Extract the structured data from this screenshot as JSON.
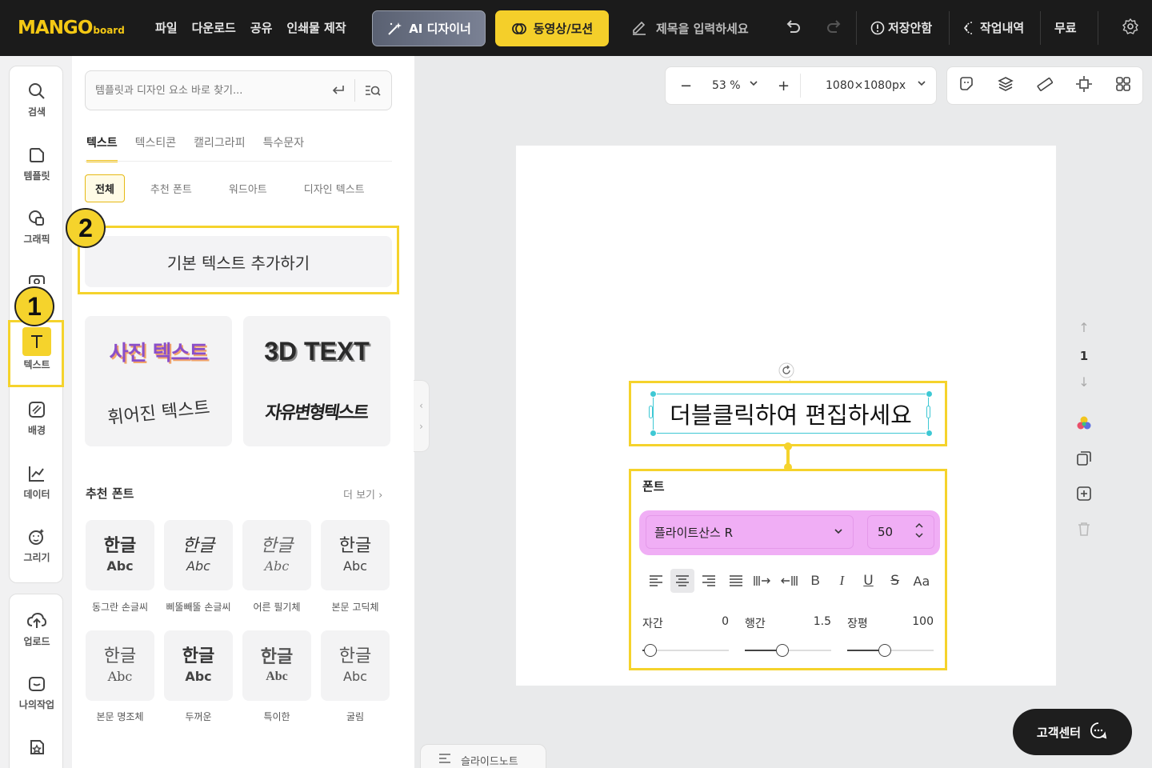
{
  "topbar": {
    "logo_main": "MANGO",
    "logo_sub": "board",
    "menu": [
      "파일",
      "다운로드",
      "공유",
      "인쇄물 제작"
    ],
    "ai_button": "AI 디자이너",
    "video_button": "동영상/모션",
    "title_placeholder": "제목을 입력하세요",
    "save_status": "저장안함",
    "history": "작업내역",
    "plan": "무료"
  },
  "rail": {
    "items": [
      "검색",
      "템플릿",
      "그래픽",
      "텍스트",
      "배경",
      "데이터",
      "그리기",
      "업로드",
      "나의작업"
    ],
    "selected": "텍스트"
  },
  "panel": {
    "search_placeholder": "템플릿과 디자인 요소 바로 찾기...",
    "tabs": [
      "텍스트",
      "텍스티콘",
      "캘리그라피",
      "특수문자"
    ],
    "chips": [
      "전체",
      "추천 폰트",
      "워드아트",
      "디자인 텍스트"
    ],
    "add_text": "기본 텍스트 추가하기",
    "styles": [
      "사진 텍스트",
      "3D TEXT",
      "휘어진 텍스트",
      "자유변형텍스트"
    ],
    "recommended_title": "추천 폰트",
    "more": "더 보기",
    "font_sample_korean": "한글",
    "font_sample_latin": "Abc",
    "fonts": [
      "동그란 손글씨",
      "삐뚤빼뚤 손글씨",
      "어른 필기체",
      "본문 고딕체",
      "본문 명조체",
      "두꺼운",
      "특이한",
      "굴림"
    ]
  },
  "badges": {
    "step1": "1",
    "step2": "2"
  },
  "canvas_toolbar": {
    "zoom": "53 %",
    "size": "1080×1080px"
  },
  "page_nav": {
    "page": "1"
  },
  "canvas": {
    "text": "더블클릭하여 편집하세요"
  },
  "font_panel": {
    "title": "폰트",
    "font_name": "플라이트산스 R",
    "font_size": "50",
    "letter_spacing_label": "자간",
    "letter_spacing": "0",
    "line_height_label": "행간",
    "line_height": "1.5",
    "width_label": "장평",
    "width": "100",
    "letter_spacing_fraction": 0.0,
    "line_height_fraction": 0.4,
    "width_fraction": 0.4
  },
  "bottom": {
    "help": "고객센터",
    "slide_note": "슬라이드노트"
  },
  "colors": {
    "accent_yellow": "#f5d32c",
    "topbar_bg": "#1b1b1b",
    "font_highlight": "#f0aef5",
    "selection_cyan": "#3ec8d4"
  }
}
